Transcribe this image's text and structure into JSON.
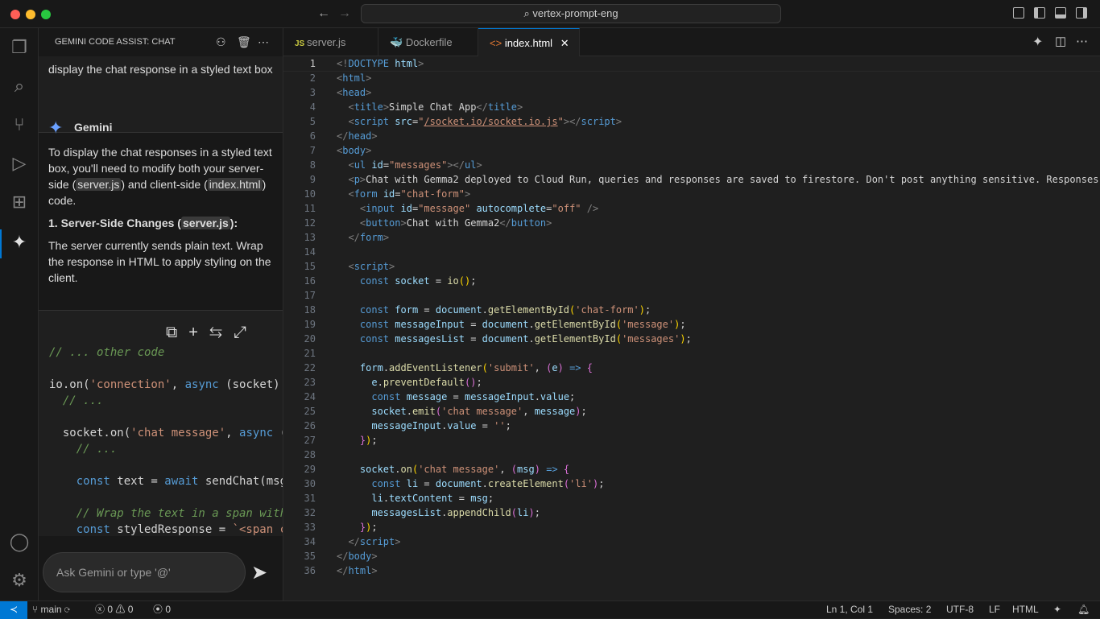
{
  "window": {
    "search": "vertex-prompt-eng",
    "colors": {
      "accent": "#0078d4",
      "close": "#ff5f57",
      "min": "#febc2e",
      "max": "#28c840"
    }
  },
  "activity": {
    "items": [
      "explorer-icon",
      "search-icon",
      "source-control-icon",
      "run-debug-icon",
      "extensions-icon",
      "gemini-icon"
    ],
    "bottom": [
      "account-icon",
      "settings-icon"
    ]
  },
  "sidebar": {
    "title": "GEMINI CODE ASSIST: CHAT",
    "user_prompt": "display the chat response in a styled text box",
    "agent_name": "Gemini",
    "resp": {
      "p1a": "To display the chat responses in a styled text box, you'll need to modify both your server-side (",
      "p1b": "server.js",
      "p1c": ") and client-side (",
      "p1d": "index.html",
      "p1e": ") code.",
      "h1a": "1. Server-Side Changes (",
      "h1b": "server.js",
      "h1c": "):",
      "p2": "The server currently sends plain text. Wrap the response in HTML to apply styling on the client."
    },
    "code": [
      [
        [
          "c",
          "// ... other code"
        ]
      ],
      [],
      [
        [
          "x",
          "io.on("
        ],
        [
          "s",
          "'connection'"
        ],
        [
          "x",
          ", "
        ],
        [
          "k",
          "async"
        ],
        [
          "x",
          " (socket)"
        ]
      ],
      [
        [
          "c",
          "  // ..."
        ]
      ],
      [],
      [
        [
          "x",
          "  socket.on("
        ],
        [
          "s",
          "'chat message'"
        ],
        [
          "x",
          ", "
        ],
        [
          "k",
          "async"
        ],
        [
          "x",
          " ("
        ]
      ],
      [
        [
          "c",
          "    // ..."
        ]
      ],
      [],
      [
        [
          "k",
          "    const"
        ],
        [
          "x",
          " text = "
        ],
        [
          "k",
          "await"
        ],
        [
          "x",
          " sendChat(msg"
        ]
      ],
      [],
      [
        [
          "c",
          "    // Wrap the text in a span with"
        ]
      ],
      [
        [
          "k",
          "    const"
        ],
        [
          "x",
          " styledResponse = "
        ],
        [
          "s",
          "`<span c"
        ]
      ]
    ],
    "input_placeholder": "Ask Gemini or type '@'"
  },
  "tabs": [
    {
      "label": "server.js",
      "icon": "JS"
    },
    {
      "label": "Dockerfile",
      "icon": "docker-icon"
    },
    {
      "label": "index.html",
      "icon": "<>",
      "active": true
    }
  ],
  "editor": {
    "current_line": 1,
    "lines": [
      [
        [
          "p",
          "<!"
        ],
        [
          "t",
          "DOCTYPE"
        ],
        [
          "x",
          " "
        ],
        [
          "a",
          "html"
        ],
        [
          "p",
          ">"
        ]
      ],
      [
        [
          "p",
          "<"
        ],
        [
          "t",
          "html"
        ],
        [
          "p",
          ">"
        ]
      ],
      [
        [
          "p",
          "<"
        ],
        [
          "t",
          "head"
        ],
        [
          "p",
          ">"
        ]
      ],
      [
        [
          "x",
          "  "
        ],
        [
          "p",
          "<"
        ],
        [
          "t",
          "title"
        ],
        [
          "p",
          ">"
        ],
        [
          "x",
          "Simple Chat App"
        ],
        [
          "p",
          "</"
        ],
        [
          "t",
          "title"
        ],
        [
          "p",
          ">"
        ]
      ],
      [
        [
          "x",
          "  "
        ],
        [
          "p",
          "<"
        ],
        [
          "t",
          "script"
        ],
        [
          "x",
          " "
        ],
        [
          "a",
          "src"
        ],
        [
          "x",
          "="
        ],
        [
          "s",
          "\""
        ],
        [
          "u",
          "/socket.io/socket.io.js"
        ],
        [
          "s",
          "\""
        ],
        [
          "p",
          "></"
        ],
        [
          "t",
          "script"
        ],
        [
          "p",
          ">"
        ]
      ],
      [
        [
          "p",
          "</"
        ],
        [
          "t",
          "head"
        ],
        [
          "p",
          ">"
        ]
      ],
      [
        [
          "p",
          "<"
        ],
        [
          "t",
          "body"
        ],
        [
          "p",
          ">"
        ]
      ],
      [
        [
          "x",
          "  "
        ],
        [
          "p",
          "<"
        ],
        [
          "t",
          "ul"
        ],
        [
          "x",
          " "
        ],
        [
          "a",
          "id"
        ],
        [
          "x",
          "="
        ],
        [
          "s",
          "\"messages\""
        ],
        [
          "p",
          "></"
        ],
        [
          "t",
          "ul"
        ],
        [
          "p",
          ">"
        ]
      ],
      [
        [
          "x",
          "  "
        ],
        [
          "p",
          "<"
        ],
        [
          "t",
          "p"
        ],
        [
          "p",
          ">"
        ],
        [
          "x",
          "Chat with Gemma2 deployed to Cloud Run, queries and responses are saved to firestore. Don't post anything sensitive. Responses"
        ]
      ],
      [
        [
          "x",
          "  "
        ],
        [
          "p",
          "<"
        ],
        [
          "t",
          "form"
        ],
        [
          "x",
          " "
        ],
        [
          "a",
          "id"
        ],
        [
          "x",
          "="
        ],
        [
          "s",
          "\"chat-form\""
        ],
        [
          "p",
          ">"
        ]
      ],
      [
        [
          "x",
          "    "
        ],
        [
          "p",
          "<"
        ],
        [
          "t",
          "input"
        ],
        [
          "x",
          " "
        ],
        [
          "a",
          "id"
        ],
        [
          "x",
          "="
        ],
        [
          "s",
          "\"message\""
        ],
        [
          "x",
          " "
        ],
        [
          "a",
          "autocomplete"
        ],
        [
          "x",
          "="
        ],
        [
          "s",
          "\"off\""
        ],
        [
          "x",
          " "
        ],
        [
          "p",
          "/>"
        ]
      ],
      [
        [
          "x",
          "    "
        ],
        [
          "p",
          "<"
        ],
        [
          "t",
          "button"
        ],
        [
          "p",
          ">"
        ],
        [
          "x",
          "Chat with Gemma2"
        ],
        [
          "p",
          "</"
        ],
        [
          "t",
          "button"
        ],
        [
          "p",
          ">"
        ]
      ],
      [
        [
          "x",
          "  "
        ],
        [
          "p",
          "</"
        ],
        [
          "t",
          "form"
        ],
        [
          "p",
          ">"
        ]
      ],
      [],
      [
        [
          "x",
          "  "
        ],
        [
          "p",
          "<"
        ],
        [
          "t",
          "script"
        ],
        [
          "p",
          ">"
        ]
      ],
      [
        [
          "x",
          "    "
        ],
        [
          "k",
          "const"
        ],
        [
          "x",
          " "
        ],
        [
          "v",
          "socket"
        ],
        [
          "x",
          " = "
        ],
        [
          "f",
          "io"
        ],
        [
          "y",
          "()"
        ],
        [
          "x",
          ";"
        ]
      ],
      [],
      [
        [
          "x",
          "    "
        ],
        [
          "k",
          "const"
        ],
        [
          "x",
          " "
        ],
        [
          "v",
          "form"
        ],
        [
          "x",
          " = "
        ],
        [
          "v",
          "document"
        ],
        [
          "x",
          "."
        ],
        [
          "f",
          "getElementById"
        ],
        [
          "y",
          "("
        ],
        [
          "s",
          "'chat-form'"
        ],
        [
          "y",
          ")"
        ],
        [
          "x",
          ";"
        ]
      ],
      [
        [
          "x",
          "    "
        ],
        [
          "k",
          "const"
        ],
        [
          "x",
          " "
        ],
        [
          "v",
          "messageInput"
        ],
        [
          "x",
          " = "
        ],
        [
          "v",
          "document"
        ],
        [
          "x",
          "."
        ],
        [
          "f",
          "getElementById"
        ],
        [
          "y",
          "("
        ],
        [
          "s",
          "'message'"
        ],
        [
          "y",
          ")"
        ],
        [
          "x",
          ";"
        ]
      ],
      [
        [
          "x",
          "    "
        ],
        [
          "k",
          "const"
        ],
        [
          "x",
          " "
        ],
        [
          "v",
          "messagesList"
        ],
        [
          "x",
          " = "
        ],
        [
          "v",
          "document"
        ],
        [
          "x",
          "."
        ],
        [
          "f",
          "getElementById"
        ],
        [
          "y",
          "("
        ],
        [
          "s",
          "'messages'"
        ],
        [
          "y",
          ")"
        ],
        [
          "x",
          ";"
        ]
      ],
      [],
      [
        [
          "x",
          "    "
        ],
        [
          "v",
          "form"
        ],
        [
          "x",
          "."
        ],
        [
          "f",
          "addEventListener"
        ],
        [
          "y",
          "("
        ],
        [
          "s",
          "'submit'"
        ],
        [
          "x",
          ", "
        ],
        [
          "m",
          "("
        ],
        [
          "v",
          "e"
        ],
        [
          "m",
          ")"
        ],
        [
          "x",
          " "
        ],
        [
          "k",
          "=>"
        ],
        [
          "x",
          " "
        ],
        [
          "m",
          "{"
        ]
      ],
      [
        [
          "x",
          "      "
        ],
        [
          "v",
          "e"
        ],
        [
          "x",
          "."
        ],
        [
          "f",
          "preventDefault"
        ],
        [
          "m",
          "()"
        ],
        [
          "x",
          ";"
        ]
      ],
      [
        [
          "x",
          "      "
        ],
        [
          "k",
          "const"
        ],
        [
          "x",
          " "
        ],
        [
          "v",
          "message"
        ],
        [
          "x",
          " = "
        ],
        [
          "v",
          "messageInput"
        ],
        [
          "x",
          "."
        ],
        [
          "v",
          "value"
        ],
        [
          "x",
          ";"
        ]
      ],
      [
        [
          "x",
          "      "
        ],
        [
          "v",
          "socket"
        ],
        [
          "x",
          "."
        ],
        [
          "f",
          "emit"
        ],
        [
          "m",
          "("
        ],
        [
          "s",
          "'chat message'"
        ],
        [
          "x",
          ", "
        ],
        [
          "v",
          "message"
        ],
        [
          "m",
          ")"
        ],
        [
          "x",
          ";"
        ]
      ],
      [
        [
          "x",
          "      "
        ],
        [
          "v",
          "messageInput"
        ],
        [
          "x",
          "."
        ],
        [
          "v",
          "value"
        ],
        [
          "x",
          " = "
        ],
        [
          "s",
          "''"
        ],
        [
          "x",
          ";"
        ]
      ],
      [
        [
          "x",
          "    "
        ],
        [
          "m",
          "}"
        ],
        [
          "y",
          ")"
        ],
        [
          "x",
          ";"
        ]
      ],
      [],
      [
        [
          "x",
          "    "
        ],
        [
          "v",
          "socket"
        ],
        [
          "x",
          "."
        ],
        [
          "f",
          "on"
        ],
        [
          "y",
          "("
        ],
        [
          "s",
          "'chat message'"
        ],
        [
          "x",
          ", "
        ],
        [
          "m",
          "("
        ],
        [
          "v",
          "msg"
        ],
        [
          "m",
          ")"
        ],
        [
          "x",
          " "
        ],
        [
          "k",
          "=>"
        ],
        [
          "x",
          " "
        ],
        [
          "m",
          "{"
        ]
      ],
      [
        [
          "x",
          "      "
        ],
        [
          "k",
          "const"
        ],
        [
          "x",
          " "
        ],
        [
          "v",
          "li"
        ],
        [
          "x",
          " = "
        ],
        [
          "v",
          "document"
        ],
        [
          "x",
          "."
        ],
        [
          "f",
          "createElement"
        ],
        [
          "m",
          "("
        ],
        [
          "s",
          "'li'"
        ],
        [
          "m",
          ")"
        ],
        [
          "x",
          ";"
        ]
      ],
      [
        [
          "x",
          "      "
        ],
        [
          "v",
          "li"
        ],
        [
          "x",
          "."
        ],
        [
          "v",
          "textContent"
        ],
        [
          "x",
          " = "
        ],
        [
          "v",
          "msg"
        ],
        [
          "x",
          ";"
        ]
      ],
      [
        [
          "x",
          "      "
        ],
        [
          "v",
          "messagesList"
        ],
        [
          "x",
          "."
        ],
        [
          "f",
          "appendChild"
        ],
        [
          "m",
          "("
        ],
        [
          "v",
          "li"
        ],
        [
          "m",
          ")"
        ],
        [
          "x",
          ";"
        ]
      ],
      [
        [
          "x",
          "    "
        ],
        [
          "m",
          "}"
        ],
        [
          "y",
          ")"
        ],
        [
          "x",
          ";"
        ]
      ],
      [
        [
          "x",
          "  "
        ],
        [
          "p",
          "</"
        ],
        [
          "t",
          "script"
        ],
        [
          "p",
          ">"
        ]
      ],
      [
        [
          "p",
          "</"
        ],
        [
          "t",
          "body"
        ],
        [
          "p",
          ">"
        ]
      ],
      [
        [
          "p",
          "</"
        ],
        [
          "t",
          "html"
        ],
        [
          "p",
          ">"
        ]
      ]
    ]
  },
  "status": {
    "branch": "main",
    "errors": "0",
    "warnings": "0",
    "ports": "0",
    "position": "Ln 1, Col 1",
    "spaces": "Spaces: 2",
    "encoding": "UTF-8",
    "eol": "LF",
    "language": "HTML"
  }
}
